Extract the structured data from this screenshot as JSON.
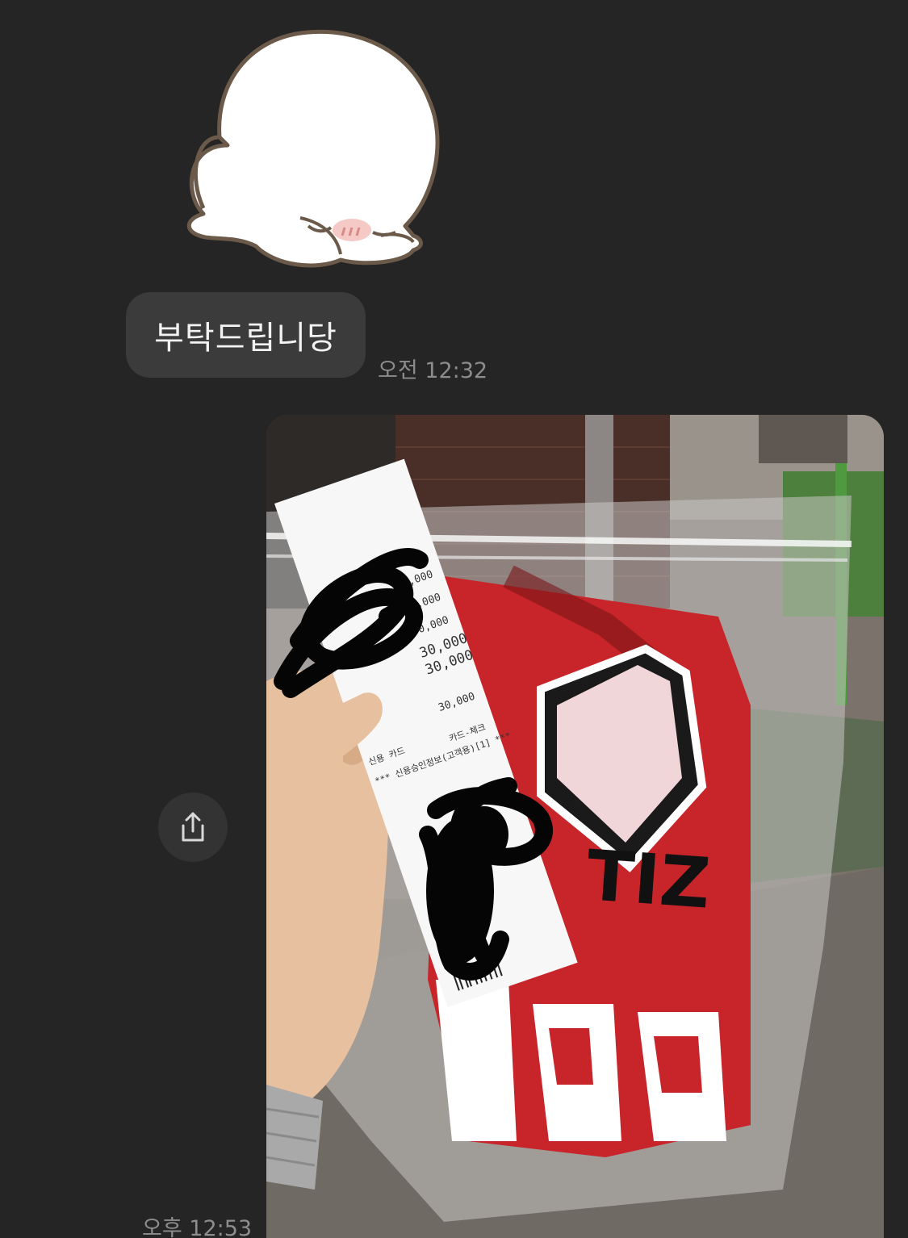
{
  "messages": [
    {
      "type": "sticker",
      "sticker_name": "white-seal-bowing-sticker"
    },
    {
      "type": "text",
      "text": "부탁드립니당",
      "time": "오전 12:32"
    },
    {
      "type": "photo",
      "photo_name": "receipt-and-jersey-photo",
      "time": "오후 12:53",
      "visible_text": {
        "jersey_text": "TIZ",
        "receipt_amounts": [
          "30,000",
          "30,000",
          "30,000",
          "30,000",
          "30,000",
          "30,000"
        ],
        "receipt_card_line": "*** 신용승인정보(고객용)[1] ***",
        "receipt_card_type": "카드-체크",
        "receipt_card_label": "신용 카드"
      }
    }
  ],
  "share_button": {
    "icon": "share-icon"
  },
  "colors": {
    "background": "#252525",
    "bubble": "#3b3b3b",
    "bubble_text": "#f2f2f2",
    "timestamp": "#8d8d8d",
    "share_button": "#333333"
  }
}
